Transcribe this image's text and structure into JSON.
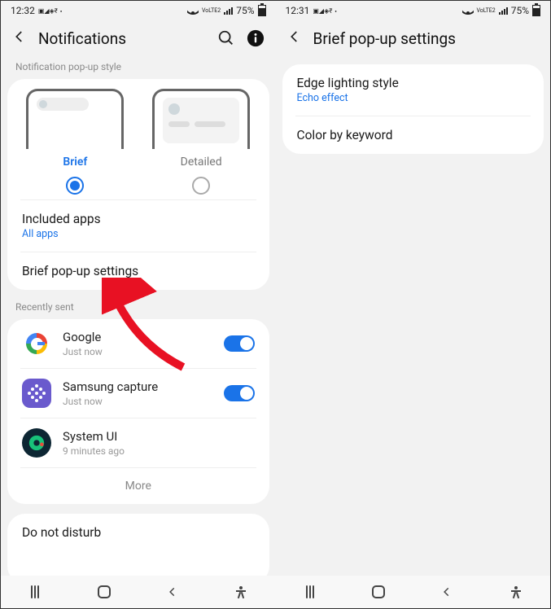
{
  "left": {
    "status": {
      "time": "12:32",
      "battery": "75%",
      "lte": "VoLTE2"
    },
    "header": {
      "title": "Notifications"
    },
    "popup_style": {
      "section_label": "Notification pop-up style",
      "brief_label": "Brief",
      "detailed_label": "Detailed",
      "selected": "brief"
    },
    "included_apps": {
      "title": "Included apps",
      "value": "All apps"
    },
    "brief_settings": {
      "title": "Brief pop-up settings"
    },
    "recently_sent": {
      "section_label": "Recently sent",
      "apps": [
        {
          "name": "Google",
          "time": "Just now",
          "toggle": true,
          "icon": "google"
        },
        {
          "name": "Samsung capture",
          "time": "Just now",
          "toggle": true,
          "icon": "samsung"
        },
        {
          "name": "System UI",
          "time": "9 minutes ago",
          "toggle": null,
          "icon": "systemui"
        }
      ],
      "more": "More"
    },
    "dnd": {
      "title": "Do not disturb"
    }
  },
  "right": {
    "status": {
      "time": "12:31",
      "battery": "75%",
      "lte": "VoLTE2"
    },
    "header": {
      "title": "Brief pop-up settings"
    },
    "rows": {
      "edge": {
        "title": "Edge lighting style",
        "value": "Echo effect"
      },
      "color": {
        "title": "Color by keyword"
      }
    }
  }
}
